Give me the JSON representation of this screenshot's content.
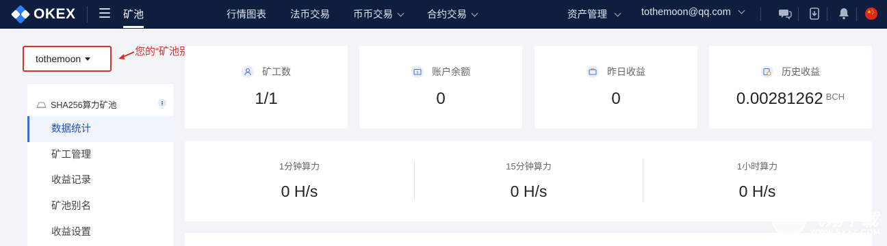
{
  "topbar": {
    "logo_text": "OKEX",
    "active_nav": "矿池",
    "nav": [
      "行情图表",
      "法币交易",
      "币币交易",
      "合约交易"
    ],
    "assets_label": "资产管理",
    "user_email": "tothemoon@qq.com",
    "colors": {
      "bg": "#0e1e3e",
      "logo_blue": "#2e7cf6"
    }
  },
  "pool_selector": {
    "value": "tothemoon"
  },
  "annotation": {
    "text": "您的“矿池别名”",
    "color": "#d8302a"
  },
  "sidebar": {
    "group_title": "SHA256算力矿池",
    "items": [
      {
        "label": "数据统计",
        "active": true
      },
      {
        "label": "矿工管理"
      },
      {
        "label": "收益记录"
      },
      {
        "label": "矿池别名"
      },
      {
        "label": "收益设置"
      }
    ]
  },
  "stats": [
    {
      "label": "矿工数",
      "value": "1/1",
      "icon": "user-icon"
    },
    {
      "label": "账户余额",
      "value": "0",
      "icon": "wallet-icon"
    },
    {
      "label": "昨日收益",
      "value": "0",
      "icon": "inbox-icon"
    },
    {
      "label": "历史收益",
      "value": "0.00281262",
      "unit": "BCH",
      "icon": "history-icon"
    }
  ],
  "hashrate": [
    {
      "label": "1分钟算力",
      "value": "0 H/s"
    },
    {
      "label": "15分钟算力",
      "value": "0 H/s"
    },
    {
      "label": "1小时算力",
      "value": "0 H/s"
    }
  ],
  "watermark": {
    "text": "飞翔下载",
    "url": "WWW.FXXZ.COM"
  }
}
